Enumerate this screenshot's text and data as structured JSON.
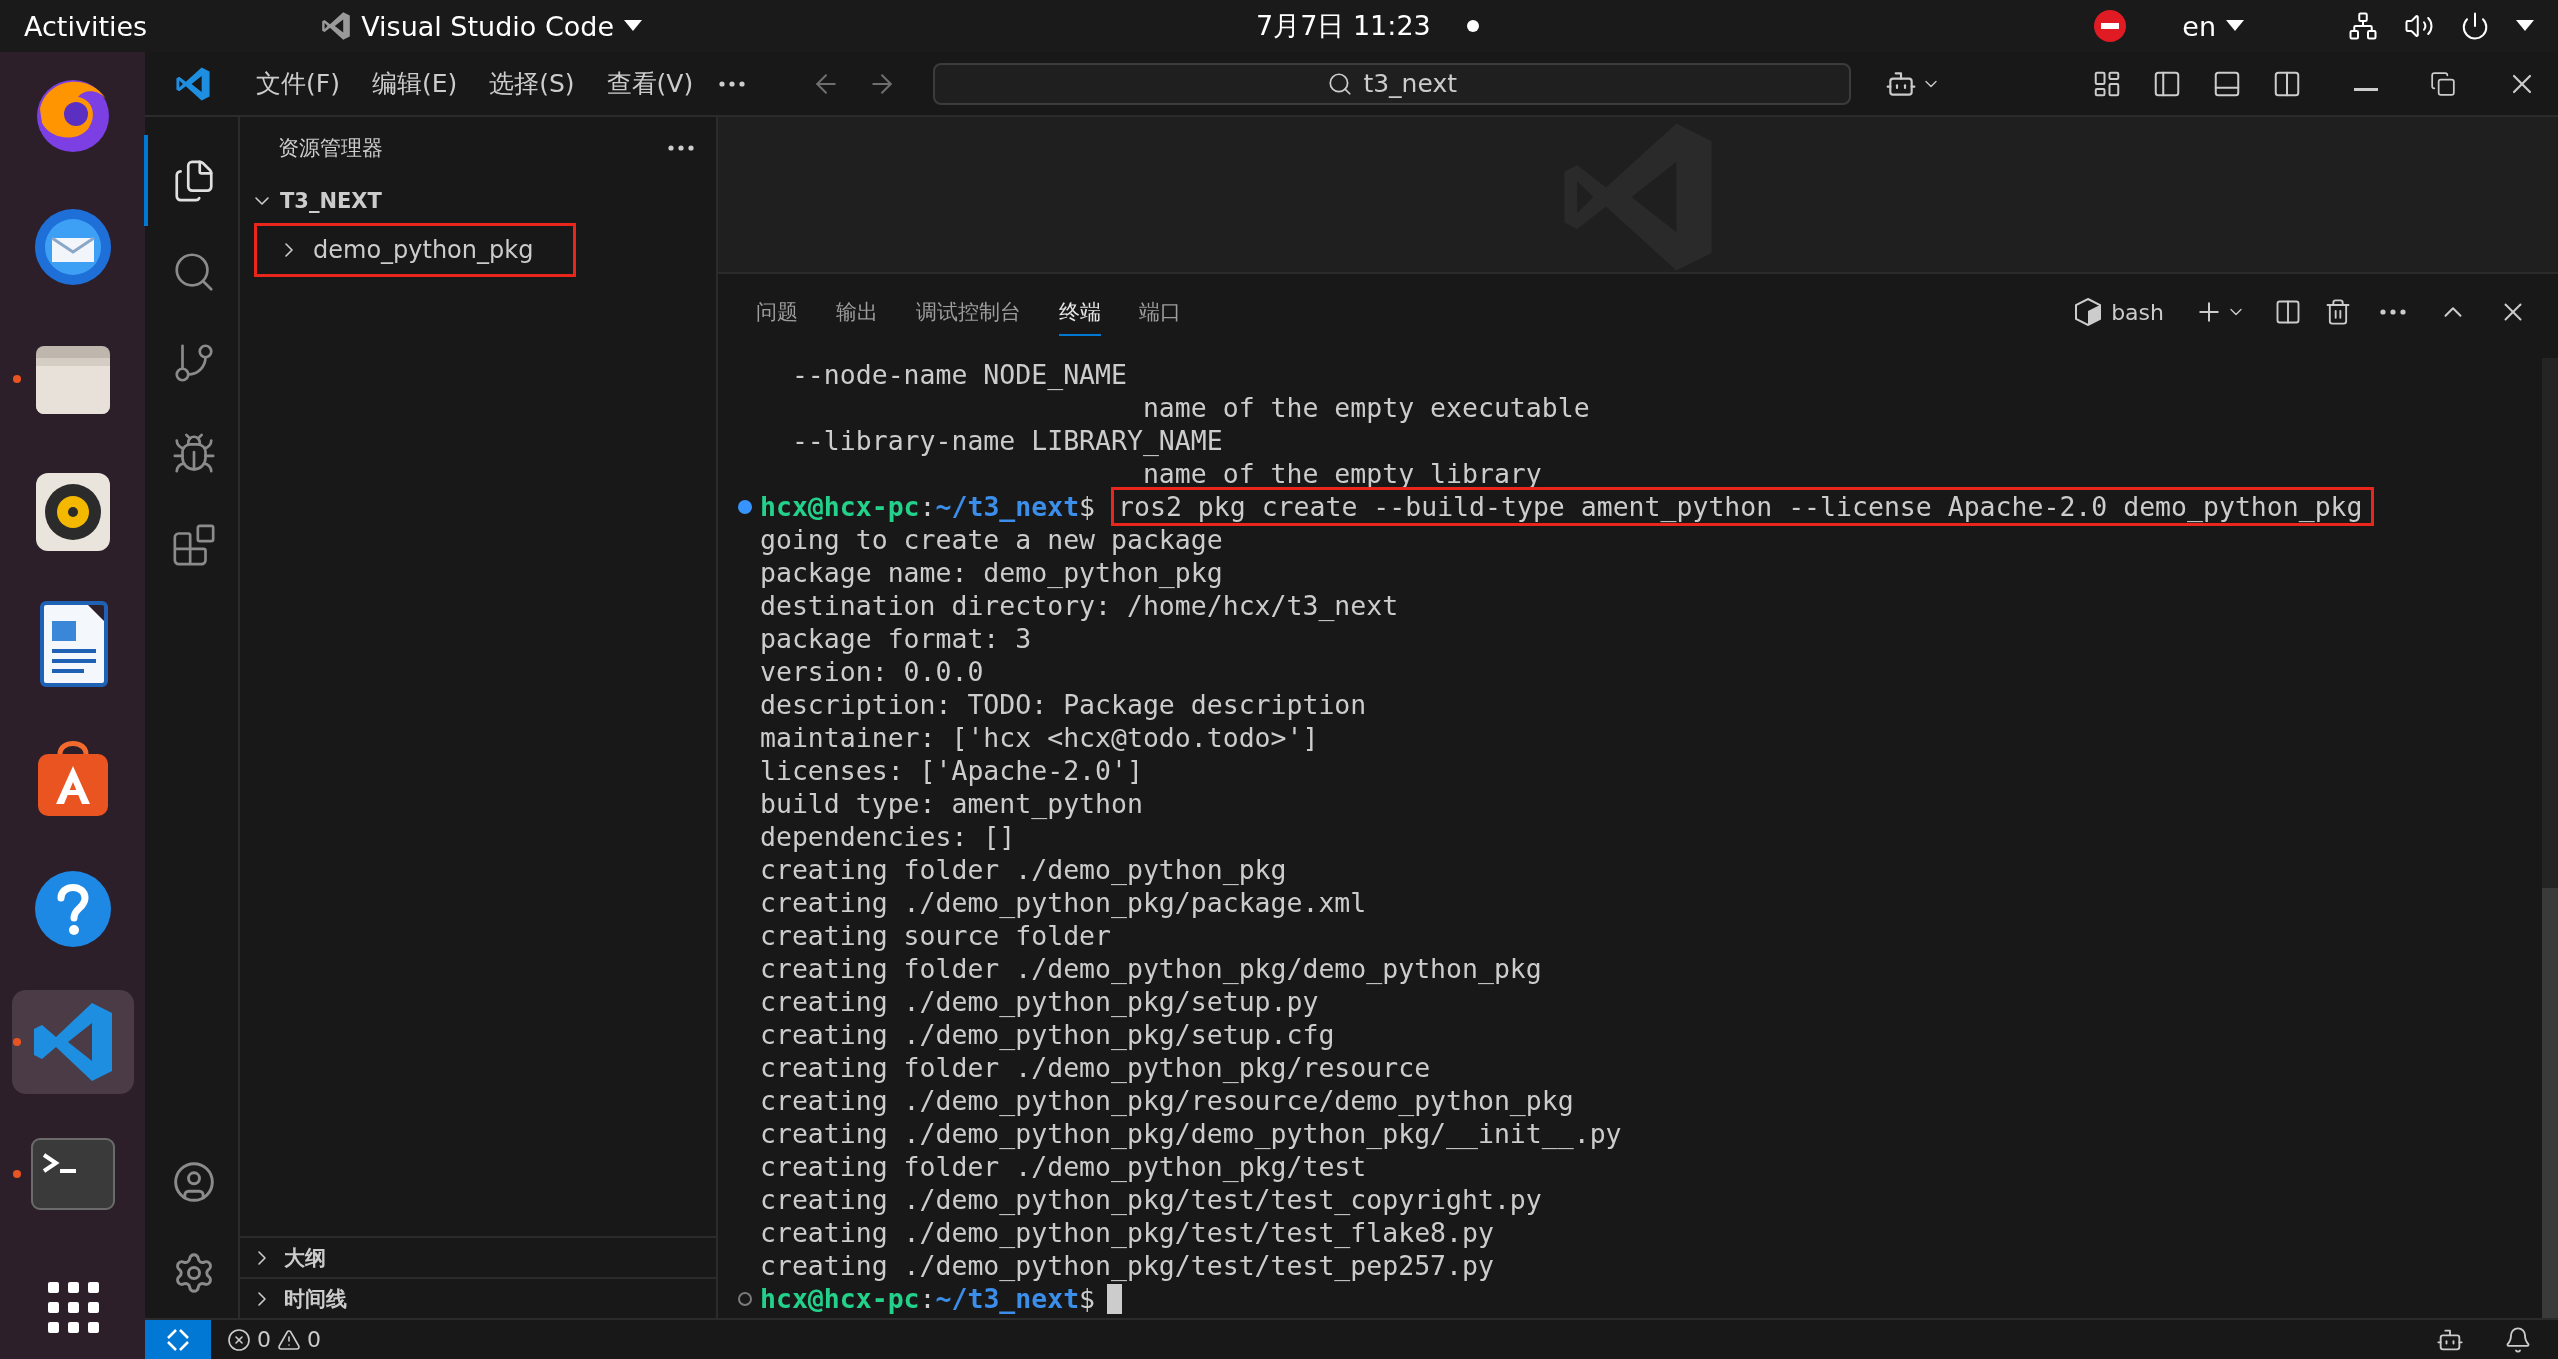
{
  "top_bar": {
    "activities": "Activities",
    "app_menu": "Visual Studio Code",
    "clock": "7月7日 11:23",
    "keyboard_layout": "en"
  },
  "dock": [
    {
      "kind": "browser",
      "running": false,
      "selected": false
    },
    {
      "kind": "mail",
      "running": false,
      "selected": false
    },
    {
      "kind": "files",
      "running": true,
      "selected": false
    },
    {
      "kind": "music",
      "running": false,
      "selected": false
    },
    {
      "kind": "writer",
      "running": false,
      "selected": false
    },
    {
      "kind": "store",
      "running": false,
      "selected": false
    },
    {
      "kind": "help",
      "running": false,
      "selected": false
    },
    {
      "kind": "code",
      "running": true,
      "selected": true
    },
    {
      "kind": "terminal",
      "running": true,
      "selected": false
    },
    {
      "kind": "apps",
      "running": false,
      "selected": false
    }
  ],
  "menu_bar": [
    "文件(F)",
    "编辑(E)",
    "选择(S)",
    "查看(V)"
  ],
  "search": {
    "value": "t3_next"
  },
  "activity_bar": [
    {
      "kind": "explorer",
      "selected": true
    },
    {
      "kind": "search",
      "selected": false
    },
    {
      "kind": "source-control",
      "selected": false
    },
    {
      "kind": "run",
      "selected": false
    },
    {
      "kind": "extensions",
      "selected": false
    }
  ],
  "explorer": {
    "title": "资源管理器",
    "folder": {
      "name": "T3_NEXT",
      "expanded": true,
      "children": [
        {
          "name": "demo_python_pkg",
          "expanded": false,
          "highlighted": true
        }
      ]
    },
    "sections": [
      {
        "label": "大纲",
        "expanded": false
      },
      {
        "label": "时间线",
        "expanded": false
      }
    ]
  },
  "panel": {
    "tabs": [
      {
        "label": "问题",
        "selected": false
      },
      {
        "label": "输出",
        "selected": false
      },
      {
        "label": "调试控制台",
        "selected": false
      },
      {
        "label": "终端",
        "selected": true
      },
      {
        "label": "端口",
        "selected": false
      }
    ],
    "shell": "bash"
  },
  "terminal": {
    "lines": [
      {
        "kind": "output",
        "text": "  --node-name NODE_NAME"
      },
      {
        "kind": "output",
        "text": "                        name of the empty executable"
      },
      {
        "kind": "output",
        "text": "  --library-name LIBRARY_NAME"
      },
      {
        "kind": "output",
        "text": "                        name of the empty library"
      },
      {
        "kind": "prompt",
        "user": "hcx@hcx-pc",
        "separator": ":",
        "path": "~/t3_next",
        "symbol": "$",
        "command": "ros2 pkg create --build-type ament_python --license Apache-2.0 demo_python_pkg",
        "finished": true,
        "highlighted": true
      },
      {
        "kind": "output",
        "text": "going to create a new package"
      },
      {
        "kind": "output",
        "text": "package name: demo_python_pkg"
      },
      {
        "kind": "output",
        "text": "destination directory: /home/hcx/t3_next"
      },
      {
        "kind": "output",
        "text": "package format: 3"
      },
      {
        "kind": "output",
        "text": "version: 0.0.0"
      },
      {
        "kind": "output",
        "text": "description: TODO: Package description"
      },
      {
        "kind": "output",
        "text": "maintainer: ['hcx <hcx@todo.todo>']"
      },
      {
        "kind": "output",
        "text": "licenses: ['Apache-2.0']"
      },
      {
        "kind": "output",
        "text": "build type: ament_python"
      },
      {
        "kind": "output",
        "text": "dependencies: []"
      },
      {
        "kind": "output",
        "text": "creating folder ./demo_python_pkg"
      },
      {
        "kind": "output",
        "text": "creating ./demo_python_pkg/package.xml"
      },
      {
        "kind": "output",
        "text": "creating source folder"
      },
      {
        "kind": "output",
        "text": "creating folder ./demo_python_pkg/demo_python_pkg"
      },
      {
        "kind": "output",
        "text": "creating ./demo_python_pkg/setup.py"
      },
      {
        "kind": "output",
        "text": "creating ./demo_python_pkg/setup.cfg"
      },
      {
        "kind": "output",
        "text": "creating folder ./demo_python_pkg/resource"
      },
      {
        "kind": "output",
        "text": "creating ./demo_python_pkg/resource/demo_python_pkg"
      },
      {
        "kind": "output",
        "text": "creating ./demo_python_pkg/demo_python_pkg/__init__.py"
      },
      {
        "kind": "output",
        "text": "creating folder ./demo_python_pkg/test"
      },
      {
        "kind": "output",
        "text": "creating ./demo_python_pkg/test/test_copyright.py"
      },
      {
        "kind": "output",
        "text": "creating ./demo_python_pkg/test/test_flake8.py"
      },
      {
        "kind": "output",
        "text": "creating ./demo_python_pkg/test/test_pep257.py"
      },
      {
        "kind": "prompt",
        "user": "hcx@hcx-pc",
        "separator": ":",
        "path": "~/t3_next",
        "symbol": "$",
        "finished": false
      }
    ]
  },
  "status_bar": {
    "errors": "0",
    "warnings": "0"
  }
}
